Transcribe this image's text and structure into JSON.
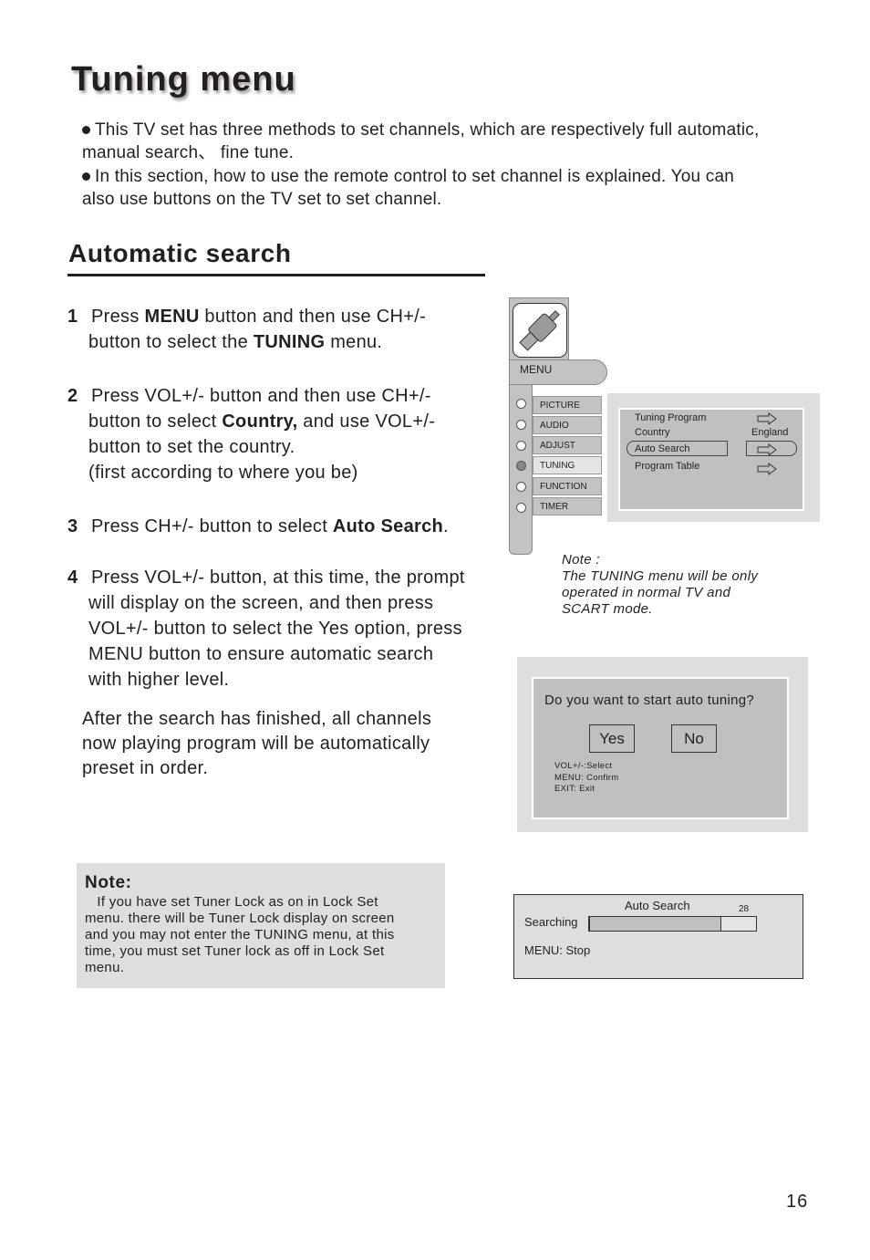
{
  "title": "Tuning menu",
  "intro": [
    {
      "text_line1": "This TV set has three methods to set channels, which are respectively full automatic,",
      "text_line2": "manual search、 fine tune."
    },
    {
      "text_line1": "In this section, how to use the remote control  to set channel is explained. You can",
      "text_line2": "also use buttons on the TV set to set channel."
    }
  ],
  "section_title": "Automatic search",
  "steps": [
    {
      "num": "1",
      "parts": [
        [
          "Press ",
          "MENU",
          " button and then use CH+/-"
        ],
        [
          "button to select the ",
          "TUNING",
          " menu."
        ]
      ]
    },
    {
      "num": "2",
      "lines": [
        "Press VOL+/- button and then use CH+/-",
        "button to select ",
        "Country,",
        " and use VOL+/-",
        "button to set the country.",
        "(first according to where you be)"
      ]
    },
    {
      "num": "3",
      "pre": "Press CH+/- button to select ",
      "bold": "Auto Search",
      "post": "."
    },
    {
      "num": "4",
      "lines": [
        "Press VOL+/- button, at this time, the prompt",
        "will display on the screen, and then press",
        "VOL+/- button to select the Yes option, press",
        "MENU button to ensure automatic search",
        "with higher level."
      ]
    }
  ],
  "after_text": [
    "After the search has finished, all channels",
    "now playing program will be automatically",
    "preset in order."
  ],
  "menu_diagram": {
    "header_label": "MENU",
    "icon": "scart-plug-icon",
    "items": [
      {
        "label": "PICTURE",
        "selected": false
      },
      {
        "label": "AUDIO",
        "selected": false
      },
      {
        "label": "ADJUST",
        "selected": false
      },
      {
        "label": "TUNING",
        "selected": true
      },
      {
        "label": "FUNCTION",
        "selected": false
      },
      {
        "label": "TIMER",
        "selected": false
      }
    ],
    "submenu": [
      {
        "label": "Tuning Program",
        "value": "arrow-right-icon"
      },
      {
        "label": "Country",
        "value": "England"
      },
      {
        "label": "Auto Search",
        "value": "arrow-right-icon",
        "highlighted": true
      },
      {
        "label": "Program Table",
        "value": "arrow-right-icon"
      }
    ]
  },
  "note_right": {
    "title": "Note :",
    "lines": [
      "The TUNING menu will be only",
      "operated  in normal TV and",
      "SCART mode."
    ]
  },
  "dialog": {
    "question": "Do you want to start auto tuning?",
    "yes_label": "Yes",
    "no_label": "No",
    "help": [
      "VOL+/-:Select",
      "MENU: Confirm",
      "EXIT: Exit"
    ]
  },
  "note_box": {
    "title": "Note:",
    "lines": [
      "   If you have set Tuner Lock as on in Lock Set",
      "menu. there will be Tuner Lock display on screen",
      "and you may not enter the TUNING menu, at this",
      "time, you must set Tuner lock as off in Lock Set",
      "menu."
    ]
  },
  "progress_panel": {
    "title": "Auto Search",
    "channel_number": "28",
    "label": "Searching",
    "progress_percent": 79,
    "stop_hint": "MENU: Stop"
  },
  "page_number": "16"
}
